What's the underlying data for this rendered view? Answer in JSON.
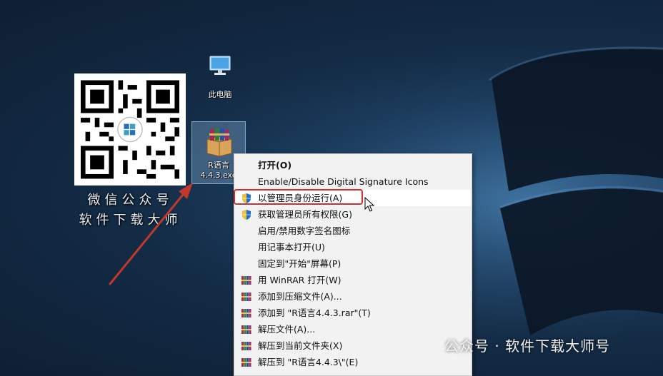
{
  "desktop": {
    "qr": {
      "caption_line1": "微信公众号",
      "caption_line2": "软件下载大师"
    },
    "icons": [
      {
        "label": "此电脑"
      },
      {
        "label_line1": "R语言",
        "label_line2": "4.4.3.exe"
      }
    ]
  },
  "context_menu": {
    "items": [
      {
        "label": "打开(O)",
        "icon": "",
        "bold": true
      },
      {
        "label": "Enable/Disable Digital Signature Icons",
        "icon": ""
      },
      {
        "label": "以管理员身份运行(A)",
        "icon": "uac-shield-icon",
        "highlighted": true
      },
      {
        "label": "获取管理员所有权限(G)",
        "icon": "uac-shield-icon"
      },
      {
        "label": "启用/禁用数字签名图标",
        "icon": ""
      },
      {
        "label": "用记事本打开(U)",
        "icon": ""
      },
      {
        "label": "固定到\"开始\"屏幕(P)",
        "icon": ""
      },
      {
        "label": "用 WinRAR 打开(W)",
        "icon": "winrar-icon"
      },
      {
        "label": "添加到压缩文件(A)...",
        "icon": "winrar-icon"
      },
      {
        "label": "添加到 \"R语言4.4.3.rar\"(T)",
        "icon": "winrar-icon"
      },
      {
        "label": "解压文件(A)...",
        "icon": "winrar-icon"
      },
      {
        "label": "解压到当前文件夹(X)",
        "icon": "winrar-icon"
      },
      {
        "label": "解压到 \"R语言4.4.3\\\"(E)",
        "icon": "winrar-icon"
      }
    ]
  },
  "watermark": {
    "text": "公众号 · 软件下载大师号"
  },
  "colors": {
    "highlight_border": "#d92b2b",
    "annotation_arrow": "#c0392b",
    "menu_bg": "#f2f2f2"
  }
}
